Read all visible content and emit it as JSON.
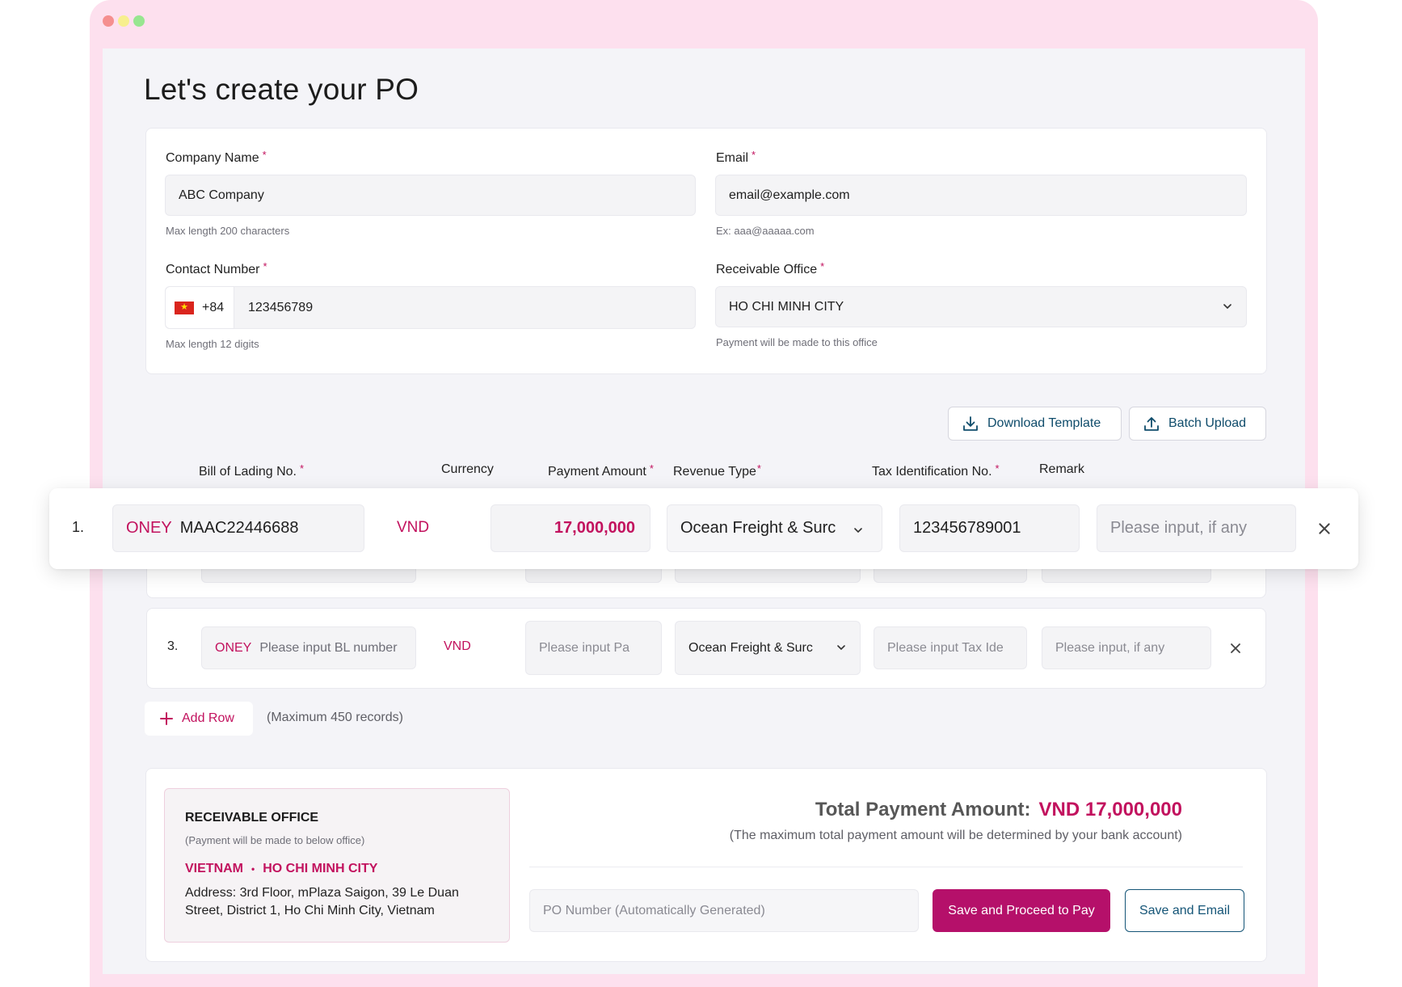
{
  "page": {
    "title": "Let's create your PO"
  },
  "form": {
    "company": {
      "label": "Company Name",
      "value": "ABC Company",
      "hint": "Max length 200 characters"
    },
    "email": {
      "label": "Email",
      "value": "email@example.com",
      "hint": "Ex: aaa@aaaaa.com"
    },
    "contact": {
      "label": "Contact Number",
      "country_code": "+84",
      "value": "123456789",
      "hint": "Max length 12 digits"
    },
    "office": {
      "label": "Receivable Office",
      "value": "HO CHI MINH CITY",
      "hint": "Payment will be made to this office"
    },
    "required_mark": "*"
  },
  "toolbar": {
    "download_label": "Download Template",
    "batch_label": "Batch Upload"
  },
  "table": {
    "headers": [
      "Bill of Lading No.",
      "Currency",
      "Payment Amount",
      "Revenue Type",
      "Tax Identification No.",
      "Remark"
    ],
    "rows": [
      {
        "num": "1.",
        "prefix": "ONEY",
        "bl": "MAAC22446688",
        "currency": "VND",
        "amount": "17,000,000",
        "revenue": "Ocean Freight & Surc",
        "tax": "123456789001",
        "remark_placeholder": "Please input, if any"
      },
      {
        "num": "3.",
        "prefix": "ONEY",
        "bl_placeholder": "Please input BL number",
        "currency": "VND",
        "amount_placeholder": "Please input Pa",
        "revenue": "Ocean Freight & Surc",
        "tax_placeholder": "Please input Tax Ide",
        "remark_placeholder": "Please input, if any"
      }
    ],
    "add_row_label": "Add Row",
    "max_note": "(Maximum 450 records)"
  },
  "summary": {
    "office_title": "RECEIVABLE OFFICE",
    "office_sub": "(Payment will be made to below office)",
    "country": "VIETNAM",
    "separator": "•",
    "city": "HO CHI MINH CITY",
    "address": "Address: 3rd Floor, mPlaza Saigon, 39 Le Duan Street, District 1, Ho Chi Minh City, Vietnam",
    "total_label": "Total Payment Amount:",
    "total_amount": "VND 17,000,000",
    "total_note": "(The maximum total payment amount will be determined by your bank account)",
    "po_placeholder": "PO Number (Automatically Generated)",
    "primary_button": "Save and Proceed to Pay",
    "secondary_button": "Save and Email"
  },
  "colors": {
    "brand": "#c2125e",
    "primary_button": "#b5106a",
    "secondary": "#155577",
    "frame": "#fde0ee"
  }
}
